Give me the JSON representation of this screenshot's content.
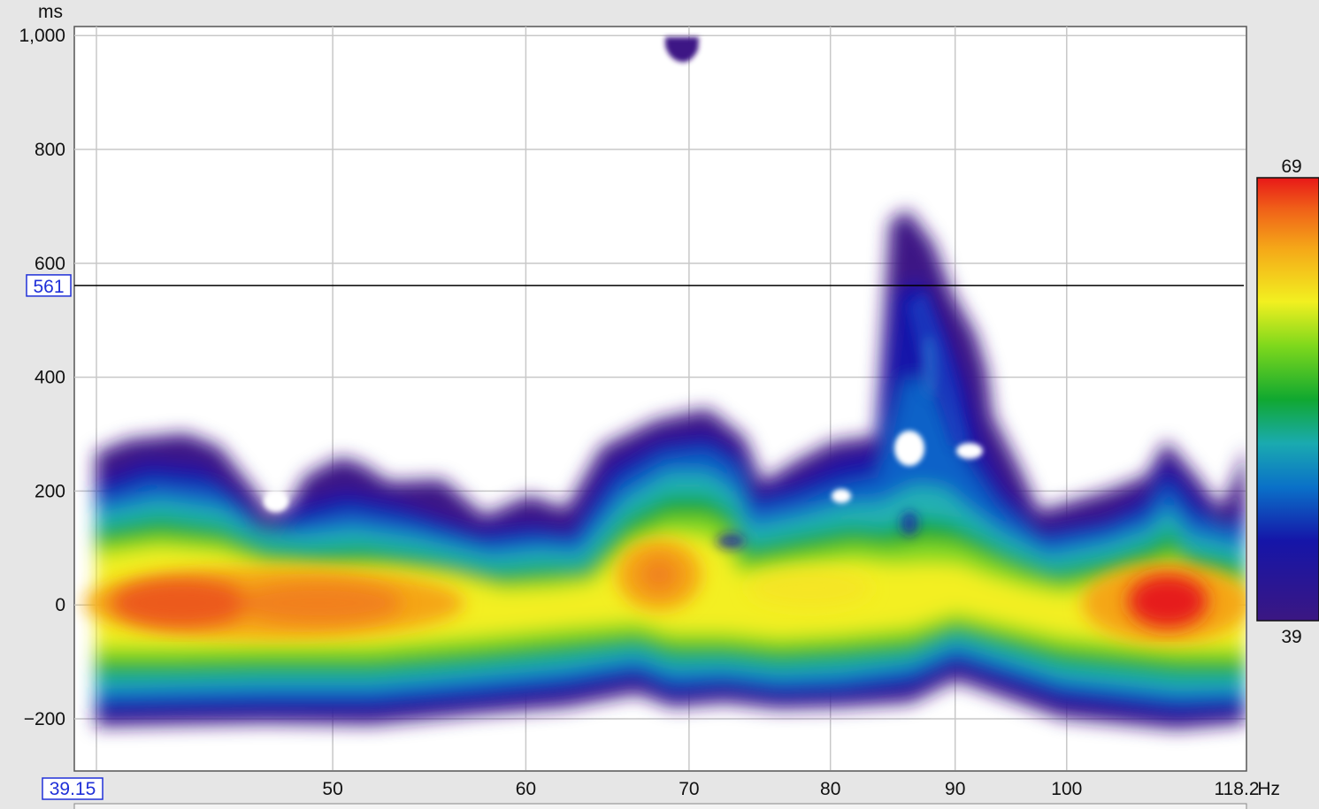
{
  "chart_data": {
    "type": "heatmap",
    "title": "",
    "xlabel": "",
    "ylabel": "",
    "x_unit": "Hz",
    "y_unit": "ms",
    "x_scale": "log",
    "xlim": [
      39.15,
      118.2
    ],
    "ylim": [
      -290,
      1005
    ],
    "x_ticks": [
      50,
      60,
      70,
      80,
      90,
      100
    ],
    "x_tick_labels": [
      "50",
      "60",
      "70",
      "80",
      "90",
      "100"
    ],
    "x_min_label": "39.15",
    "x_max_label": "118.2",
    "y_ticks": [
      -200,
      0,
      200,
      400,
      600,
      800,
      1000
    ],
    "y_tick_labels": [
      "−200",
      "0",
      "200",
      "400",
      "600",
      "800",
      "1,000"
    ],
    "grid": true,
    "cursor": {
      "time_ms": 561,
      "label": "561"
    },
    "colorbar": {
      "min": 39,
      "max": 69,
      "min_label": "39",
      "max_label": "69",
      "placement": "right"
    },
    "colormap": [
      "#3b1782",
      "#1515a8",
      "#0a70c8",
      "#1aaab0",
      "#10a830",
      "#7ed81c",
      "#f2f020",
      "#f5a818",
      "#f06018",
      "#e81818"
    ],
    "hotspots": [
      {
        "freq_hz": 42.5,
        "time_ms": 0,
        "level": 66
      },
      {
        "freq_hz": 50,
        "time_ms": 0,
        "level": 63
      },
      {
        "freq_hz": 68,
        "time_ms": 50,
        "level": 63
      },
      {
        "freq_hz": 80,
        "time_ms": 10,
        "level": 56
      },
      {
        "freq_hz": 109,
        "time_ms": 0,
        "level": 69
      }
    ]
  }
}
